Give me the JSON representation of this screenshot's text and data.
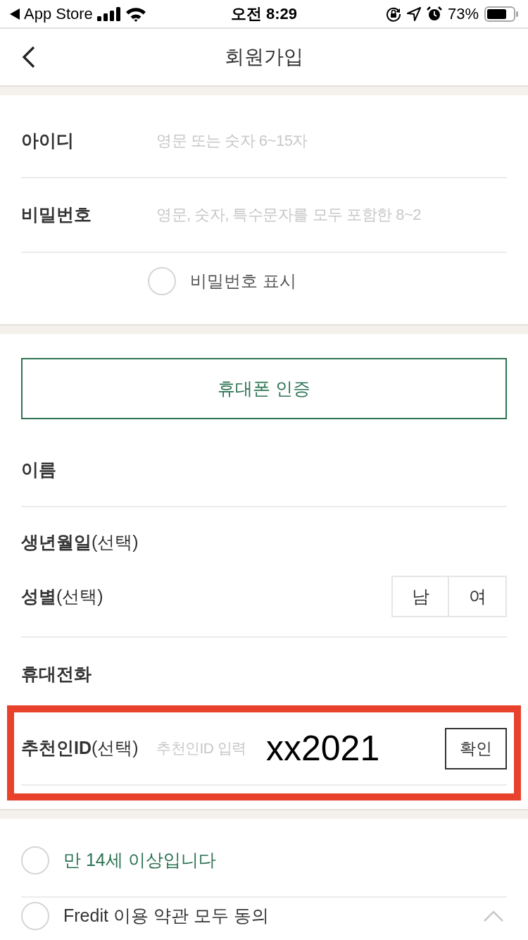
{
  "status_bar": {
    "back_label": "App Store",
    "time": "오전 8:29",
    "battery": "73%"
  },
  "header": {
    "title": "회원가입"
  },
  "account": {
    "fields": [
      {
        "label": "아이디",
        "placeholder": "영문 또는 숫자 6~15자"
      },
      {
        "label": "비밀번호",
        "placeholder": "영문, 숫자, 특수문자를 모두 포함한 8~2"
      }
    ],
    "show_password": {
      "label": "비밀번호 표시",
      "checked": false
    }
  },
  "phone_verify_button": "휴대폰 인증",
  "profile_rows": [
    {
      "kind": "label",
      "label": "이름"
    },
    {
      "kind": "label",
      "label": "생년월일",
      "note": "(선택)"
    },
    {
      "kind": "gender",
      "label": "성별",
      "note": "(선택)",
      "options": [
        {
          "label": "남",
          "selected": false
        },
        {
          "label": "여",
          "selected": false
        }
      ]
    },
    {
      "kind": "label",
      "label": "휴대전화"
    }
  ],
  "referral": {
    "label": "추천인ID",
    "note": "(선택)",
    "placeholder": "추천인ID 입력",
    "annotation": "xx2021",
    "button": "확인",
    "highlighted": true
  },
  "agreements": [
    {
      "kind": "single",
      "label": "만 14세 이상입니다",
      "checked": false,
      "color": "#2d7353"
    },
    {
      "kind": "group",
      "label": "Fredit 이용 약관 모두 동의",
      "checked": false,
      "color": "#333333",
      "expanded": true
    }
  ]
}
